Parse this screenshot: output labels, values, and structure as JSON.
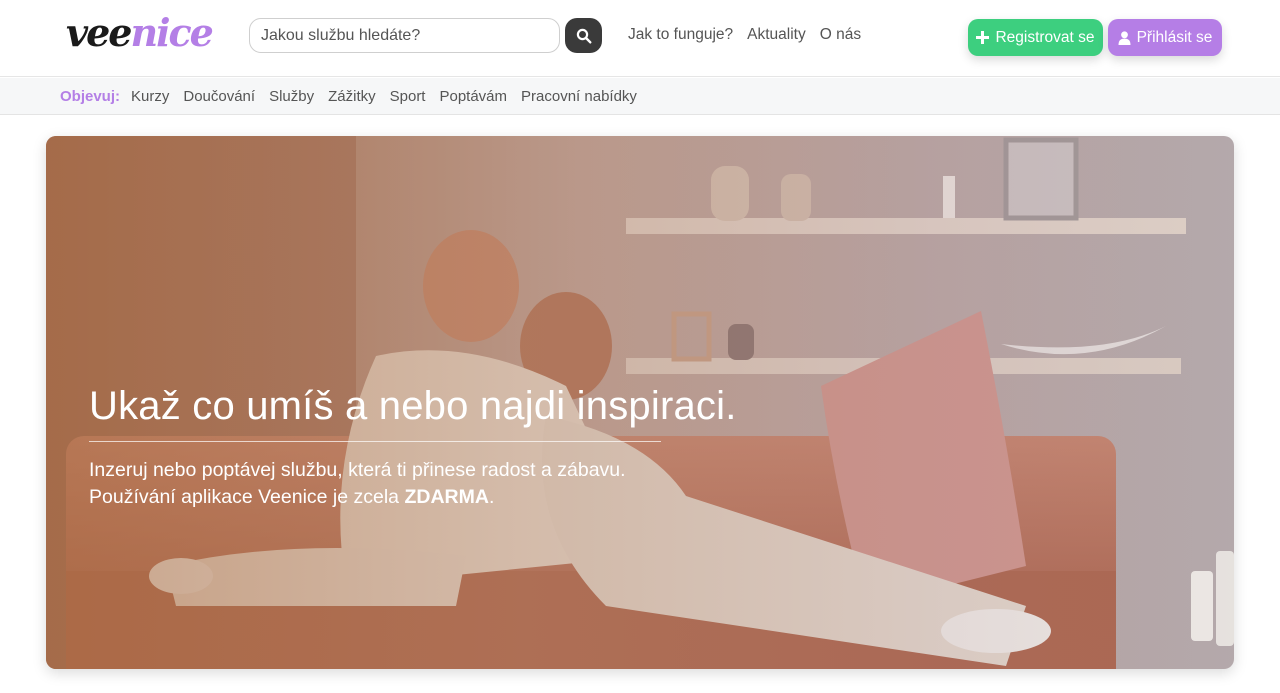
{
  "logo": {
    "part1": "vee",
    "part2": "nice"
  },
  "search": {
    "placeholder": "Jakou službu hledáte?"
  },
  "topnav": [
    "Jak to funguje?",
    "Aktuality",
    "O nás"
  ],
  "buttons": {
    "register": "Registrovat se",
    "login": "Přihlásit se"
  },
  "categories": {
    "label": "Objevuj:",
    "items": [
      "Kurzy",
      "Doučování",
      "Služby",
      "Zážitky",
      "Sport",
      "Poptávám",
      "Pracovní nabídky"
    ]
  },
  "hero": {
    "title": "Ukaž co umíš a nebo najdi inspiraci.",
    "line1": "Inzeruj nebo poptávej službu, která ti přinese radost a zábavu.",
    "line2_prefix": "Používání aplikace Veenice je zcela ",
    "line2_bold": "ZDARMA",
    "line2_suffix": "."
  },
  "colors": {
    "brand_purple": "#b47fe6",
    "register_green": "#3dcf7f",
    "login_purple": "#b57ee6",
    "search_button": "#3a3a3a"
  }
}
